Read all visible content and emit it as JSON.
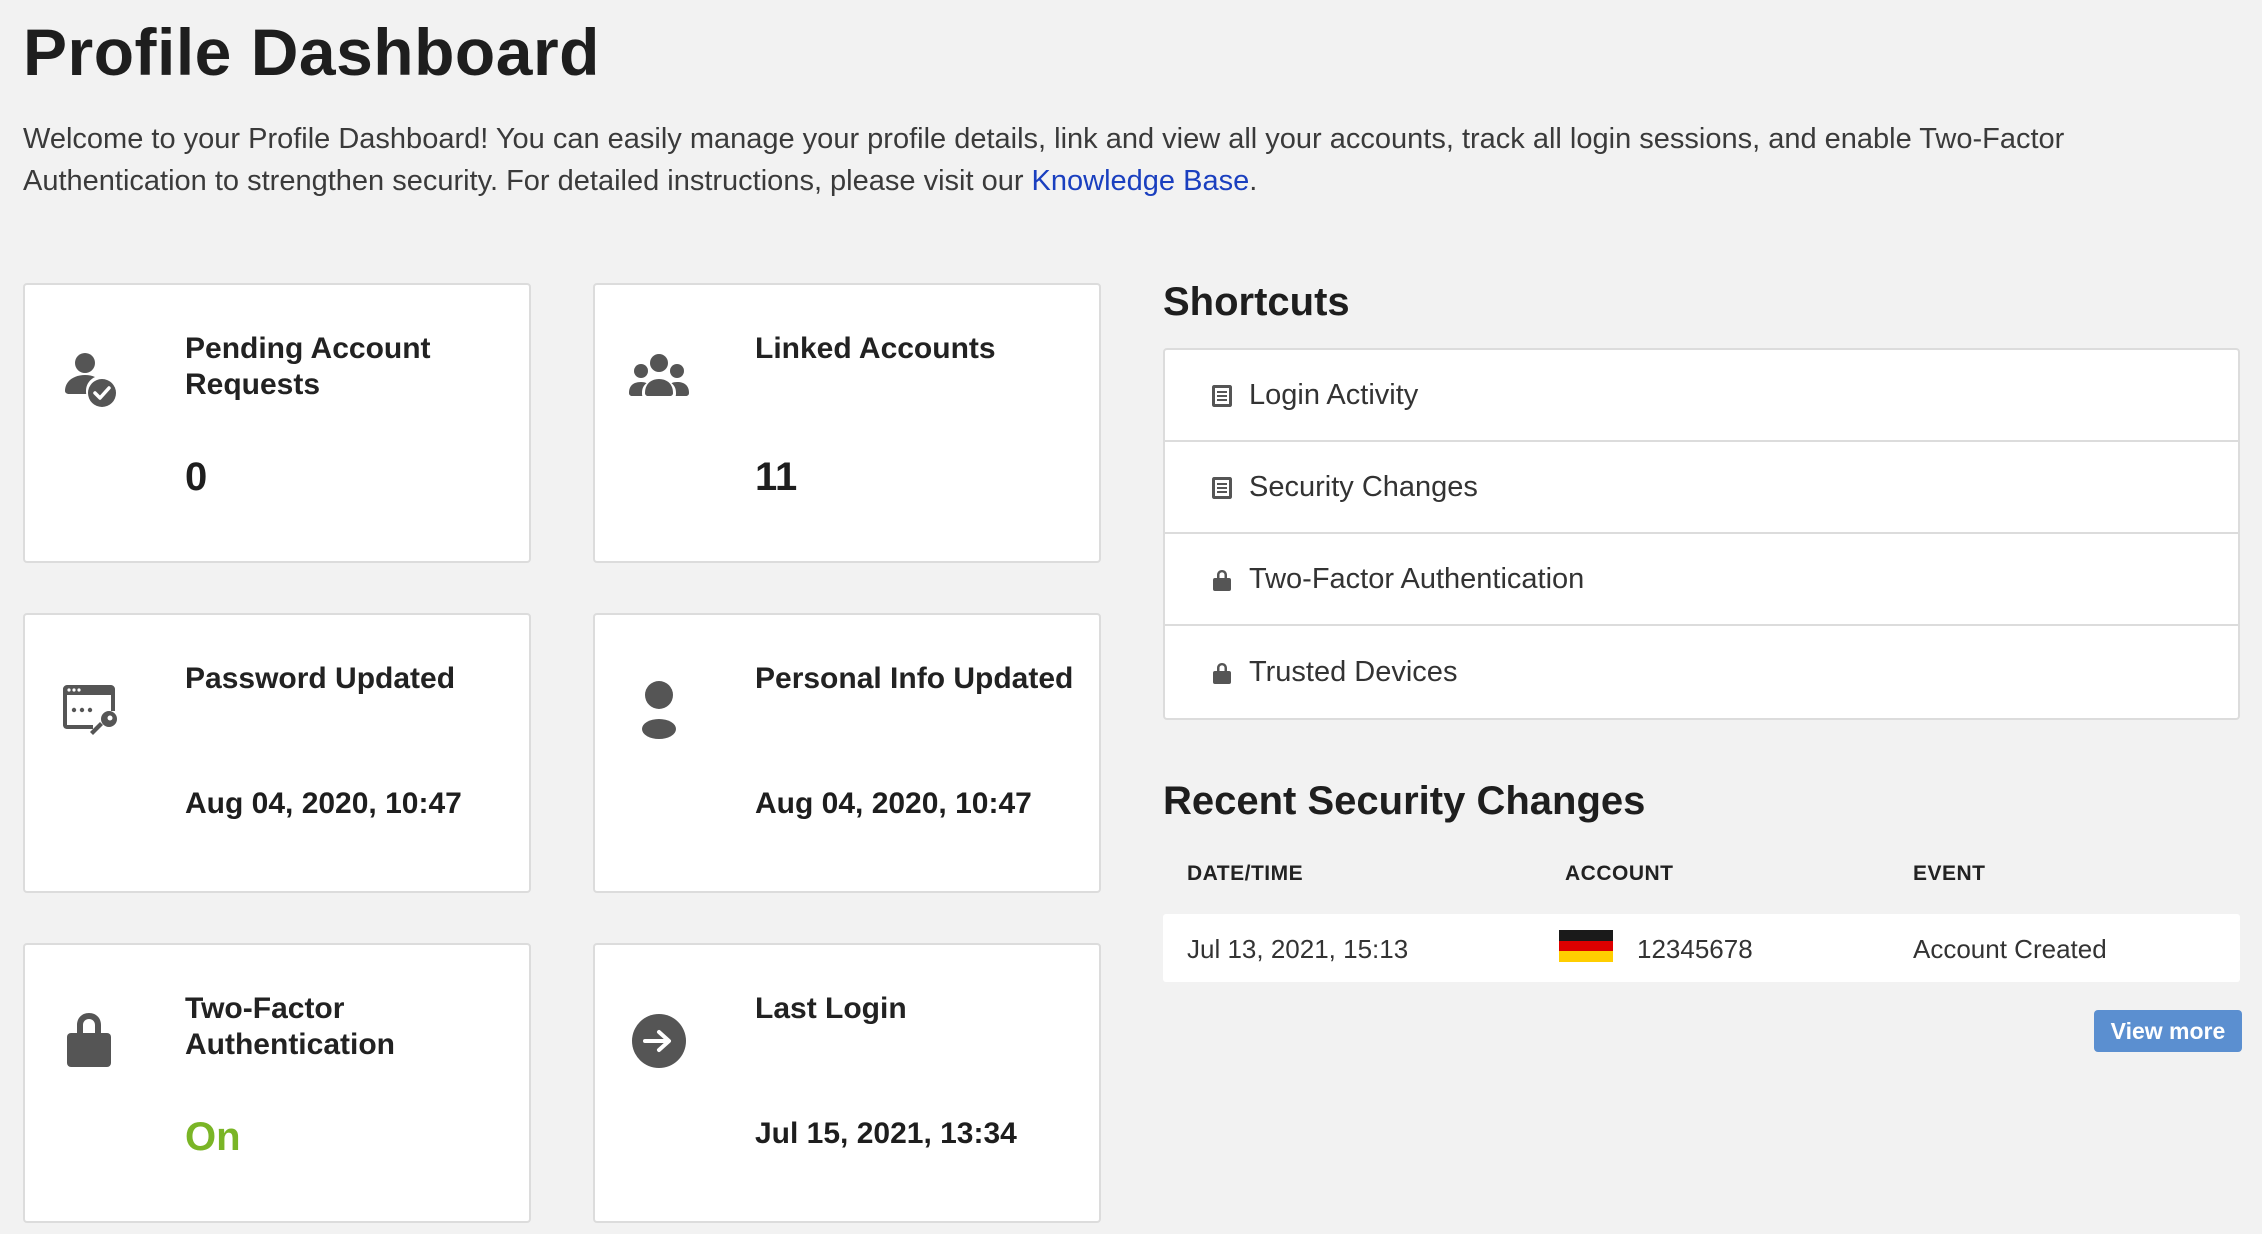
{
  "page": {
    "title": "Profile Dashboard",
    "intro": {
      "text": "Welcome to your Profile Dashboard! You can easily manage your profile details, link and view all your accounts, track all login sessions, and enable Two-Factor Authentication to strengthen security. For detailed instructions, please visit our ",
      "link": "Knowledge Base",
      "suffix": "."
    }
  },
  "cards": {
    "pending": {
      "label": "Pending Account Requests",
      "value": "0",
      "icon": "user-check-icon"
    },
    "linked": {
      "label": "Linked Accounts",
      "value": "11",
      "icon": "group-icon"
    },
    "password": {
      "label": "Password Updated",
      "value": "Aug 04, 2020, 10:47",
      "icon": "password-key-icon"
    },
    "personal": {
      "label": "Personal Info Updated",
      "value": "Aug 04, 2020, 10:47",
      "icon": "person-icon"
    },
    "twofactor": {
      "label": "Two-Factor Authentication",
      "value": "On",
      "icon": "lock-icon"
    },
    "lastlogin": {
      "label": "Last Login",
      "value": "Jul 15, 2021, 13:34",
      "icon": "login-arrow-icon"
    }
  },
  "colors": {
    "on_green": "#7ab526",
    "accent_blue": "#5b8fd0",
    "link_blue": "#1a3fbf"
  },
  "shortcuts": {
    "title": "Shortcuts",
    "items": [
      {
        "label": "Login Activity",
        "icon": "document-icon"
      },
      {
        "label": "Security Changes",
        "icon": "document-icon"
      },
      {
        "label": "Two-Factor Authentication",
        "icon": "lock-icon"
      },
      {
        "label": "Trusted Devices",
        "icon": "lock-icon"
      }
    ]
  },
  "recent": {
    "title": "Recent Security Changes",
    "columns": [
      "DATE/TIME",
      "ACCOUNT",
      "EVENT"
    ],
    "rows": [
      {
        "datetime": "Jul 13, 2021, 15:13",
        "flag": "germany-flag-icon",
        "account": "12345678",
        "event": "Account Created"
      }
    ],
    "view_more": "View more"
  }
}
